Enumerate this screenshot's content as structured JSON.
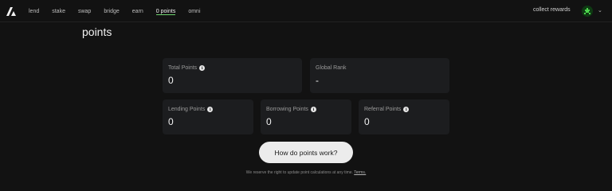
{
  "nav": {
    "items": [
      {
        "label": "lend"
      },
      {
        "label": "stake"
      },
      {
        "label": "swap"
      },
      {
        "label": "bridge"
      },
      {
        "label": "earn"
      },
      {
        "label": "0 points",
        "active": true
      },
      {
        "label": "omni"
      }
    ],
    "collect_label": "collect rewards",
    "chevron": "⌄",
    "logo_icon": "brand-logo-icon",
    "avatar_icon": "user-avatar-icon"
  },
  "page_title": "points",
  "cards": {
    "total": {
      "label": "Total Points",
      "value": "0"
    },
    "rank": {
      "label": "Global Rank",
      "value": "-"
    },
    "lending": {
      "label": "Lending Points",
      "value": "0"
    },
    "borrowing": {
      "label": "Borrowing Points",
      "value": "0"
    },
    "referral": {
      "label": "Referral Points",
      "value": "0"
    }
  },
  "info_glyph": "i",
  "cta_label": "How do points work?",
  "disclaimer": {
    "text": "We reserve the right to update point calculations at any time.",
    "terms": "Terms."
  },
  "colors": {
    "background": "#121212",
    "card": "#1c1d1f",
    "accent": "#6fd46f"
  }
}
